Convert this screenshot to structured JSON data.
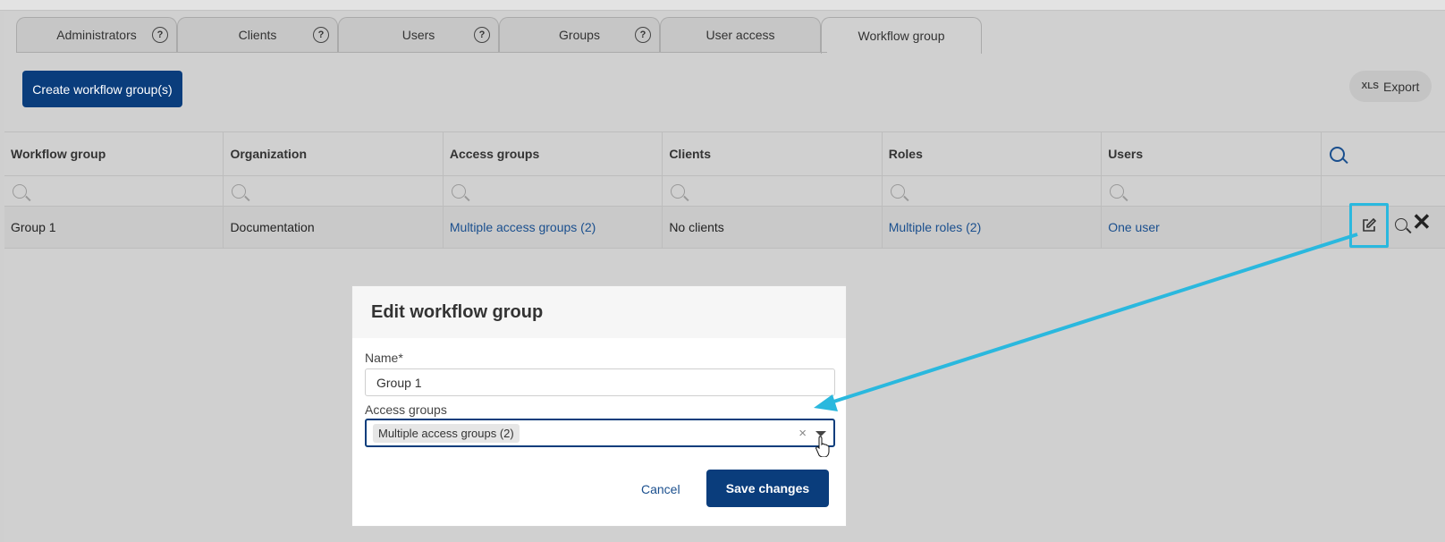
{
  "tabs": [
    {
      "label": "Administrators",
      "help": "?"
    },
    {
      "label": "Clients",
      "help": "?"
    },
    {
      "label": "Users",
      "help": "?"
    },
    {
      "label": "Groups",
      "help": "?"
    },
    {
      "label": "User access"
    },
    {
      "label": "Workflow group",
      "active": true
    }
  ],
  "toolbar": {
    "create_label": "Create workflow group(s)",
    "export_prefix": "XLS",
    "export_label": "Export"
  },
  "table": {
    "headers": [
      "Workflow group",
      "Organization",
      "Access groups",
      "Clients",
      "Roles",
      "Users"
    ],
    "rows": [
      {
        "workflow_group": "Group 1",
        "organization": "Documentation",
        "access_groups": "Multiple access groups (2)",
        "clients": "No clients",
        "roles": "Multiple roles (2)",
        "users": "One user"
      }
    ]
  },
  "modal": {
    "title": "Edit workflow group",
    "name_label": "Name*",
    "name_value": "Group 1",
    "access_label": "Access groups",
    "access_value": "Multiple access groups (2)",
    "clear_glyph": "×",
    "cancel_label": "Cancel",
    "save_label": "Save changes"
  },
  "colors": {
    "primary": "#0a3d7c",
    "link": "#1a4f8e",
    "annotation": "#2ab8de"
  },
  "icons": [
    "help-icon",
    "search-icon",
    "edit-icon",
    "close-icon",
    "chevron-down-icon",
    "pointer-cursor-icon"
  ]
}
